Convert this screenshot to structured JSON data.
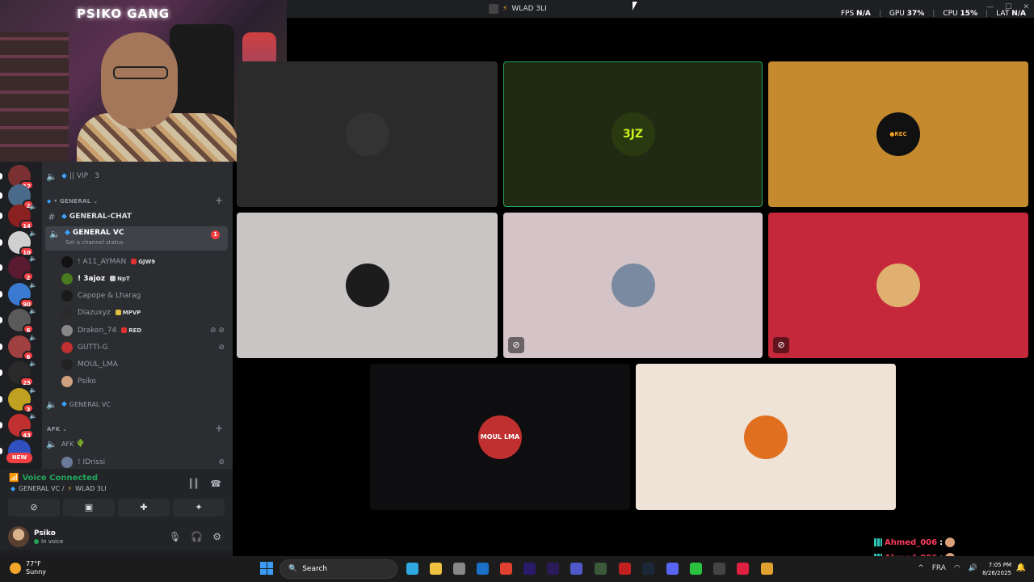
{
  "window": {
    "title": "WLAD 3LI",
    "controls": [
      "—",
      "☐",
      "✕"
    ]
  },
  "perf": {
    "fps_label": "FPS",
    "fps_value": "N/A",
    "gpu_label": "GPU",
    "gpu_value": "37%",
    "cpu_label": "CPU",
    "cpu_value": "15%",
    "lat_label": "LAT",
    "lat_value": "N/A"
  },
  "webcam": {
    "logo": "PSIKO GANG"
  },
  "servers": [
    {
      "badge": "17",
      "color": "#7a3030"
    },
    {
      "badge": "2",
      "color": "#4a6a8a"
    },
    {
      "badge": "14",
      "color": "#8a2020"
    },
    {
      "badge": "10",
      "color": "#d0d0d0"
    },
    {
      "badge": "2",
      "color": "#5a1a30"
    },
    {
      "badge": "90",
      "color": "#3a7ad0"
    },
    {
      "badge": "6",
      "color": "#5a5a5a"
    },
    {
      "badge": "6",
      "color": "#a04040"
    },
    {
      "badge": "25",
      "color": "#2a2a2a"
    },
    {
      "badge": "3",
      "color": "#c0a020"
    },
    {
      "badge": "43",
      "color": "#c03030"
    },
    {
      "badge": "",
      "color": "#3050c0"
    }
  ],
  "new_label": "NEW",
  "channels": {
    "vip": {
      "name": "|| VIP",
      "count": "3"
    },
    "category_general": "• GENERAL",
    "general_chat": "GENERAL-CHAT",
    "general_vc": "GENERAL VC",
    "general_vc_mentions": "1",
    "set_status": "Set a channel status",
    "members": [
      {
        "name": "! A11_AYMAN",
        "tag": "GJW9",
        "tag_color": "#e03030",
        "av": "#111",
        "mute": ""
      },
      {
        "name": "! 3ajoz",
        "tag": "NpT",
        "tag_color": "#cccccc",
        "av": "#4a7a20",
        "mute": "",
        "bright": true
      },
      {
        "name": "Capope & Lharag",
        "tag": "",
        "tag_color": "",
        "av": "#1a1a1a",
        "mute": ""
      },
      {
        "name": "Diazuxyz",
        "tag": "MPVP",
        "tag_color": "#e0c040",
        "av": "#2a2a2a",
        "mute": ""
      },
      {
        "name": "Draken_74",
        "tag": "RED",
        "tag_color": "#e03030",
        "av": "#888",
        "mute": "⊘ ⊘"
      },
      {
        "name": "GUTTI-G",
        "tag": "",
        "tag_color": "",
        "av": "#c03030",
        "mute": "⊘"
      },
      {
        "name": "MOUL_LMA",
        "tag": "",
        "tag_color": "",
        "av": "#222",
        "mute": ""
      },
      {
        "name": "Psiko",
        "tag": "",
        "tag_color": "",
        "av": "#d0a080",
        "mute": ""
      }
    ],
    "general_vc_2": "GENERAL VC",
    "category_afk": "AFK",
    "afk": "AFK",
    "idrissi": "! IDrissi"
  },
  "voice": {
    "status": "Voice Connected",
    "channel": "GENERAL VC /",
    "server": "WLAD 3LI",
    "buttons": [
      "⊘",
      "▣",
      "✚",
      "✦"
    ]
  },
  "user": {
    "name": "Psiko",
    "sub": "In voice"
  },
  "tiles": [
    {
      "bg": "#2b2b2b",
      "pic": "#333",
      "speaking": false,
      "mute": false
    },
    {
      "bg": "#202a12",
      "pic": "#2a3a10",
      "speaking": true,
      "mute": false
    },
    {
      "bg": "#c68a2e",
      "pic": "#111",
      "speaking": false,
      "mute": false
    },
    {
      "bg": "#c8c5c4",
      "pic": "#1c1c1c",
      "speaking": false,
      "mute": false
    },
    {
      "bg": "#d4c4c8",
      "pic": "#7a8aa0",
      "speaking": false,
      "mute": true
    },
    {
      "bg": "#c4283a",
      "pic": "#e0b070",
      "speaking": false,
      "mute": true
    },
    {
      "bg": "#0e0e10",
      "pic": "#c03030",
      "speaking": false,
      "mute": false
    },
    {
      "bg": "#efe3d8",
      "pic": "#e07020",
      "speaking": false,
      "mute": false
    }
  ],
  "tile_labels": {
    "rec": "●REC",
    "moul": "MOUL LMA",
    "ejz": "3JZ"
  },
  "chat": [
    {
      "user": "Ahmed_006"
    },
    {
      "user": "Ahmed_006"
    },
    {
      "user": "Ahmed_006"
    }
  ],
  "taskbar": {
    "temp": "77°F",
    "cond": "Sunny",
    "search": "Search",
    "time": "7:05 PM",
    "date": "8/26/2025",
    "lang": "FRA"
  }
}
